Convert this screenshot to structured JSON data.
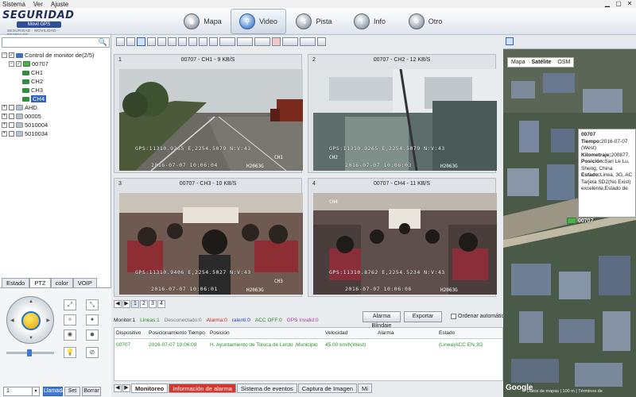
{
  "menu": [
    "Sistema",
    "Ver",
    "Ajuste"
  ],
  "logo": {
    "brand": "SEGURIDAD",
    "sub": "Movil GPS",
    "tag": "SEGURIDAD · MOVILIDAD · RESPALDO"
  },
  "nav_tabs": [
    {
      "label": "Mapa",
      "icon": "globe-icon"
    },
    {
      "label": "Video",
      "icon": "magnifier-icon"
    },
    {
      "label": "Pista",
      "icon": "track-icon"
    },
    {
      "label": "Info",
      "icon": "info-icon"
    },
    {
      "label": "Otro",
      "icon": "gear-icon"
    }
  ],
  "active_nav": "Video",
  "tree": {
    "root": "Control de monitor de(2/5)",
    "vehicle": "00707",
    "channels": [
      "CH1",
      "CH2",
      "CH3",
      "CH4"
    ],
    "selected_channel": "CH4",
    "groups": [
      "AHD.",
      "00005",
      "5010004",
      "5010034"
    ]
  },
  "left_tabs": [
    "Estado",
    "PTZ",
    "color",
    "VOIP"
  ],
  "ptz": {
    "preset_value": "1",
    "btn_llamada": "Llamada",
    "btn_set": "Set",
    "btn_borrar": "Borrar"
  },
  "videos": [
    {
      "num": "1",
      "title": "00707 - CH1 - 9 KB/S",
      "gps": "GPS:11310.9265 E,2254.5079 N:V:43",
      "date": "2016-07-07 10:06:04",
      "model": "H2063G",
      "label": "CH1"
    },
    {
      "num": "2",
      "title": "00707 - CH2 - 12 KB/S",
      "gps": "GPS:11310.9265 E,2254.5079 N:V:43",
      "date": "2016-07-07 10:06:03",
      "model": "H2063G",
      "label": "CH2"
    },
    {
      "num": "3",
      "title": "00707 - CH3 - 10 KB/S",
      "gps": "GPS:11310.9406 E,2254.5027 N:V:43",
      "date": "2016-07-07 10:06:01",
      "model": "H2063G",
      "label": "CH3"
    },
    {
      "num": "4",
      "title": "00707 - CH4 - 11 KB/S",
      "gps": "GPS:11310.8762 E,2254.5234 N:V:43",
      "date": "2016-07-07 10:06:06",
      "model": "H2063G",
      "label": "CH4"
    }
  ],
  "pages": [
    "1",
    "2",
    "3",
    "4"
  ],
  "status": {
    "monitor": "Monitor:1",
    "lineas": "Lineas:1",
    "desconectado": "Desconectado:0",
    "alarma": "Alarma:0",
    "ralenti": "ralenti:0",
    "acc_off": "ACC OFF:0",
    "gps_invalid": "GPS Invalid:0",
    "colors": {
      "lineas": "#2e8b2e",
      "alarma": "#d02020",
      "ralenti": "#2244cc",
      "acc_off": "#3a8a3a",
      "gps": "#b03aa6"
    }
  },
  "buttons": {
    "alarma_blindaje": "Alarma Blindaje",
    "exportar": "Exportar",
    "ordenar": "Ordenar automática"
  },
  "table": {
    "headers": [
      "Dispositivo",
      "Posicionamiento Tiempo",
      "Posición",
      "Velocidad",
      "Alarma",
      "Estado"
    ],
    "rows": [
      [
        "00707",
        "2016-07-07 10:06:09",
        "H. Ayuntamiento de Toluca de Lerdo ,Municipio",
        "45.00 km/h(West)",
        "",
        "(Linea)ACC EN,3G"
      ]
    ]
  },
  "bottom_tabs": [
    "Monitoreo",
    "Información de alarma",
    "Sistema de eventos",
    "Captura de Imagen",
    "Mi"
  ],
  "map": {
    "types": [
      "Mapa",
      "Satélite",
      "OSM"
    ],
    "active_type": "Satélite",
    "info": {
      "vehicle": "00707",
      "tiempo_label": "Tiempo:",
      "tiempo": "2016-07-07",
      "direction": "(West)",
      "km_label": "Kilometraje:",
      "km": "200877.",
      "pos_label": "Posición:",
      "pos": "San Le Lu, Sheng, China",
      "estado_label": "Estado:",
      "estado": "Linea, 3G, AC Tarjeta SD2(No Exist) excelente,Estado de"
    },
    "marker": "00707",
    "google": "Google",
    "footer": "Datos de mapas | 100 m | Términos de"
  }
}
